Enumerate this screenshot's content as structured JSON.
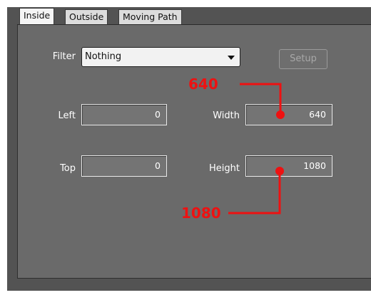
{
  "tabs": [
    {
      "label": "Inside",
      "active": true
    },
    {
      "label": "Outside",
      "active": false
    },
    {
      "label": "Moving Path",
      "active": false
    }
  ],
  "filter": {
    "label": "Filter",
    "value": "Nothing",
    "setup_label": "Setup"
  },
  "fields": {
    "left": {
      "label": "Left",
      "value": "0"
    },
    "top": {
      "label": "Top",
      "value": "0"
    },
    "width": {
      "label": "Width",
      "value": "640"
    },
    "height": {
      "label": "Height",
      "value": "1080"
    }
  },
  "annotations": {
    "width_callout": "640",
    "height_callout": "1080",
    "color": "#ee1111"
  },
  "colors": {
    "panel_bg": "#6a6a6a",
    "window_bg": "#535353"
  }
}
